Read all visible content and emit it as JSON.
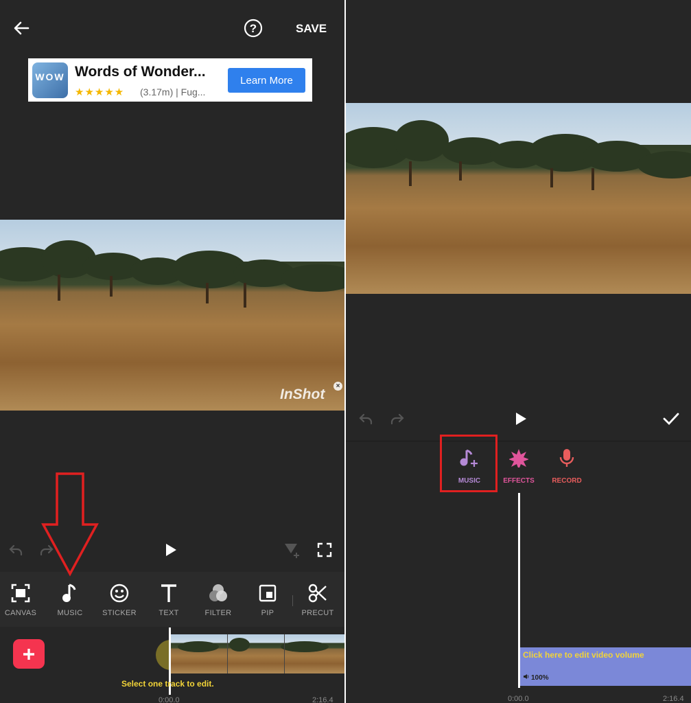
{
  "left": {
    "header": {
      "save_label": "SAVE"
    },
    "ad": {
      "title": "Words of Wonder...",
      "stars": "★★★★★",
      "meta": "(3.17m) | Fug...",
      "cta": "Learn More",
      "logo_letters": "WOW"
    },
    "watermark": "InShot",
    "toolbar": {
      "items": [
        {
          "label": "CANVAS"
        },
        {
          "label": "MUSIC"
        },
        {
          "label": "STICKER"
        },
        {
          "label": "TEXT"
        },
        {
          "label": "FILTER"
        },
        {
          "label": "PIP"
        },
        {
          "label": "PRECUT"
        }
      ]
    },
    "timeline": {
      "hint": "Select one track to edit.",
      "time_start": "0:00.0",
      "time_end": "2:16.4"
    },
    "colors": {
      "add_button": "#f5344f",
      "annotation": "#e02020",
      "hint": "#f2d438"
    }
  },
  "right": {
    "tabs": [
      {
        "label": "MUSIC",
        "color": "#b58ad6"
      },
      {
        "label": "EFFECTS",
        "color": "#e0559b"
      },
      {
        "label": "RECORD",
        "color": "#e85d5d"
      }
    ],
    "track": {
      "hint": "Click here to edit video volume",
      "volume": "100%"
    },
    "timeline": {
      "time_start": "0:00.0",
      "time_end": "2:16.4"
    }
  }
}
